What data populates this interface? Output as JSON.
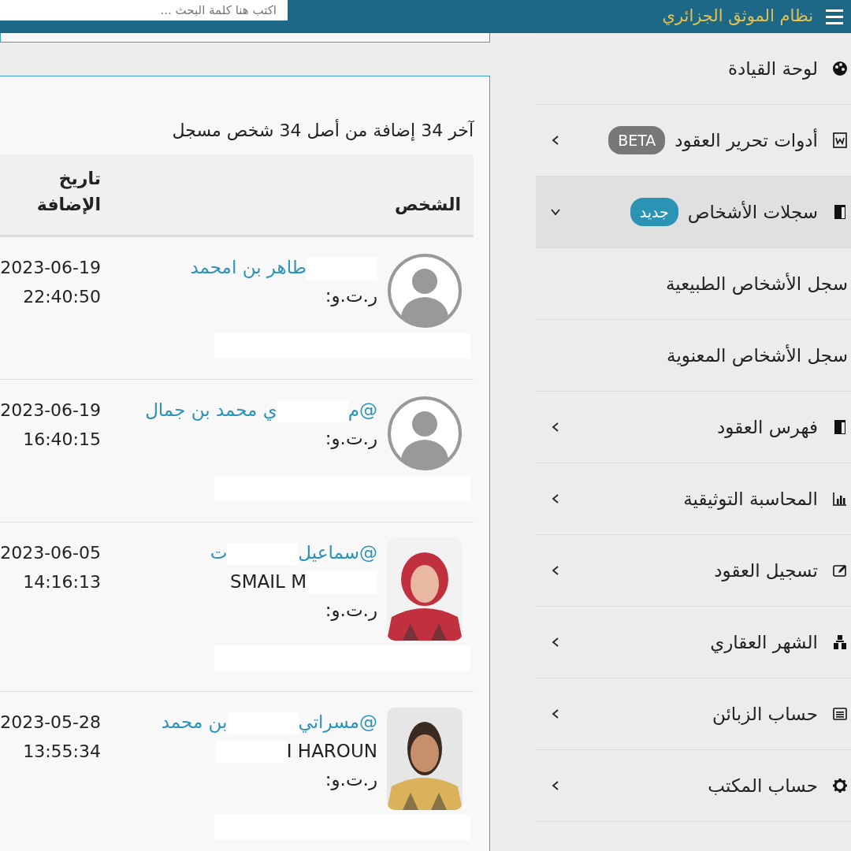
{
  "header": {
    "title": "نظام الموثق الجزائري",
    "search": {
      "placeholder": "اكتب هنا كلمة البحث ..."
    }
  },
  "sidebar": {
    "items": [
      {
        "kind": "link",
        "label": "لوحة القيادة",
        "selected": false
      },
      {
        "kind": "submenu",
        "label": "أدوات تحرير العقود",
        "badge": {
          "text": "BETA",
          "kind": "secondary"
        },
        "expanded": false,
        "selected": false
      },
      {
        "kind": "submenu",
        "label": "سجلات الأشخاص",
        "badge": {
          "text": "جديد",
          "kind": "info"
        },
        "expanded": true,
        "selected": true,
        "children": [
          {
            "label": "سجل الأشخاص الطبيعية"
          },
          {
            "label": "سجل الأشخاص المعنوية"
          }
        ]
      },
      {
        "kind": "submenu",
        "label": "فهرس العقود",
        "expanded": false,
        "selected": false
      },
      {
        "kind": "submenu",
        "label": "المحاسبة التوثيقية",
        "expanded": false,
        "selected": false
      },
      {
        "kind": "submenu",
        "label": "تسجيل العقود",
        "expanded": false,
        "selected": false
      },
      {
        "kind": "submenu",
        "label": "الشهر العقاري",
        "expanded": false,
        "selected": false
      },
      {
        "kind": "submenu",
        "label": "حساب الزبائن",
        "expanded": false,
        "selected": false
      },
      {
        "kind": "submenu",
        "label": "حساب المكتب",
        "expanded": false,
        "selected": false
      }
    ]
  },
  "summary": "آخر 34 إضافة من أصل 34 شخص مسجل",
  "table": {
    "columns": [
      "الشخص",
      "تاريخ الإضافة"
    ],
    "rows": [
      {
        "kind": "silhouette",
        "name": [
          {
            "kind": "redacted"
          },
          {
            "kind": "text",
            "text": "طاهر بن امحمد"
          }
        ],
        "latin": [],
        "id_label": "ر.ت.و:",
        "date": "2023-06-19",
        "time": "22:40:50"
      },
      {
        "kind": "silhouette",
        "name": [
          {
            "kind": "text",
            "text": "@م"
          },
          {
            "kind": "redacted"
          },
          {
            "kind": "text",
            "text": "ي محمد بن جمال"
          }
        ],
        "latin": [],
        "id_label": "ر.ت.و:",
        "date": "2023-06-19",
        "time": "16:40:15"
      },
      {
        "name": [
          {
            "kind": "text",
            "text": "@سماعيل"
          },
          {
            "kind": "redacted"
          },
          {
            "kind": "text",
            "text": "ت"
          }
        ],
        "latin": [
          {
            "kind": "text",
            "text": "SMAIL M"
          },
          {
            "kind": "redacted"
          }
        ],
        "id_label": "ر.ت.و:",
        "date": "2023-06-05",
        "time": "14:16:13"
      },
      {
        "name": [
          {
            "kind": "text",
            "text": "@مسراتي"
          },
          {
            "kind": "redacted"
          },
          {
            "kind": "text",
            "text": "بن محمد"
          }
        ],
        "latin": [
          {
            "kind": "redacted"
          },
          {
            "kind": "text",
            "text": "I HAROUN"
          }
        ],
        "id_label": "ر.ت.و:",
        "date": "2023-05-28",
        "time": "13:55:34"
      }
    ]
  }
}
